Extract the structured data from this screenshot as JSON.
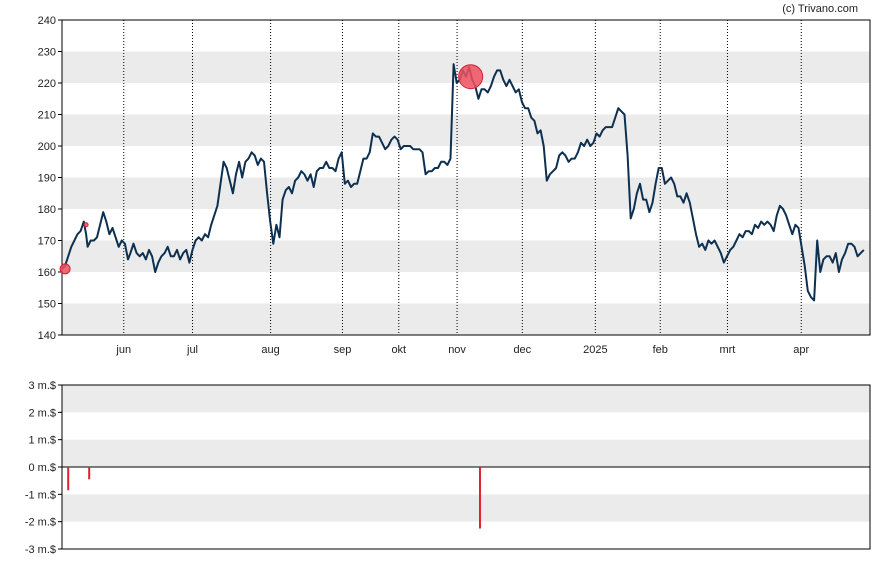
{
  "credit": "(c) Trivano.com",
  "colors": {
    "price_line": "#0d3050",
    "band": "#ebebeb",
    "marker": "#f05060",
    "marker_stroke": "#d02030",
    "volume_bar": "#e0202e",
    "grid": "#000000"
  },
  "chart_data": [
    {
      "type": "line",
      "title": "",
      "ylim": [
        140,
        240
      ],
      "y_ticks": [
        140,
        150,
        160,
        170,
        180,
        190,
        200,
        210,
        220,
        230,
        240
      ],
      "months": [
        {
          "label": "jun",
          "x": 15.9
        },
        {
          "label": "jul",
          "x": 33.6
        },
        {
          "label": "aug",
          "x": 53.7
        },
        {
          "label": "sep",
          "x": 72.2
        },
        {
          "label": "okt",
          "x": 86.7
        },
        {
          "label": "nov",
          "x": 101.7
        },
        {
          "label": "dec",
          "x": 118.5
        },
        {
          "label": "2025",
          "x": 137.3
        },
        {
          "label": "feb",
          "x": 154.0
        },
        {
          "label": "mrt",
          "x": 171.3
        },
        {
          "label": "apr",
          "x": 190.3
        }
      ],
      "x_range": [
        0,
        208
      ],
      "series": [
        {
          "points": [
            [
              0,
              161
            ],
            [
              0.8,
              162
            ],
            [
              1.6,
              165
            ],
            [
              2.4,
              168
            ],
            [
              3.2,
              170
            ],
            [
              4,
              172
            ],
            [
              4.8,
              173
            ],
            [
              5.6,
              176
            ],
            [
              6.2,
              172
            ],
            [
              6.6,
              168
            ],
            [
              7.4,
              170
            ],
            [
              8.2,
              170
            ],
            [
              9,
              171
            ],
            [
              9.8,
              175
            ],
            [
              10.6,
              179
            ],
            [
              11.4,
              176
            ],
            [
              12.2,
              172
            ],
            [
              13,
              174
            ],
            [
              13.8,
              171
            ],
            [
              14.6,
              168
            ],
            [
              15.4,
              170
            ],
            [
              16.2,
              169
            ],
            [
              17,
              164
            ],
            [
              17.6,
              166
            ],
            [
              18.4,
              169
            ],
            [
              19.2,
              166
            ],
            [
              20,
              165
            ],
            [
              20.8,
              166
            ],
            [
              21.6,
              164
            ],
            [
              22.4,
              167
            ],
            [
              23.2,
              165
            ],
            [
              24,
              160
            ],
            [
              24.8,
              163
            ],
            [
              25.6,
              165
            ],
            [
              26.4,
              166
            ],
            [
              27.2,
              168
            ],
            [
              28,
              165
            ],
            [
              28.8,
              165
            ],
            [
              29.6,
              167
            ],
            [
              30.4,
              164
            ],
            [
              31.2,
              166
            ],
            [
              32,
              167
            ],
            [
              32.8,
              163
            ],
            [
              33.6,
              167
            ],
            [
              34.4,
              170
            ],
            [
              35.2,
              171
            ],
            [
              36,
              170
            ],
            [
              36.8,
              172
            ],
            [
              37.6,
              171
            ],
            [
              38.4,
              175
            ],
            [
              39.2,
              178
            ],
            [
              40,
              181
            ],
            [
              40.8,
              188
            ],
            [
              41.6,
              195
            ],
            [
              42.4,
              193
            ],
            [
              43.2,
              189
            ],
            [
              44,
              185
            ],
            [
              44.8,
              191
            ],
            [
              45.6,
              195
            ],
            [
              46.4,
              190
            ],
            [
              47.2,
              195
            ],
            [
              48,
              196
            ],
            [
              48.8,
              198
            ],
            [
              49.6,
              197
            ],
            [
              50.4,
              194
            ],
            [
              51.2,
              196
            ],
            [
              52,
              195
            ],
            [
              52.8,
              185
            ],
            [
              53.6,
              176
            ],
            [
              54.4,
              169
            ],
            [
              55.2,
              175
            ],
            [
              56,
              171
            ],
            [
              56.8,
              183
            ],
            [
              57.6,
              186
            ],
            [
              58.4,
              187
            ],
            [
              59.2,
              185
            ],
            [
              60,
              189
            ],
            [
              60.8,
              190
            ],
            [
              61.6,
              192
            ],
            [
              62.4,
              191
            ],
            [
              63.2,
              189
            ],
            [
              64,
              191
            ],
            [
              64.8,
              187
            ],
            [
              65.6,
              192
            ],
            [
              66.4,
              193
            ],
            [
              67.2,
              193
            ],
            [
              68,
              195
            ],
            [
              68.8,
              193
            ],
            [
              69.6,
              193
            ],
            [
              70.4,
              192
            ],
            [
              71.2,
              196
            ],
            [
              72,
              198
            ],
            [
              72.8,
              188
            ],
            [
              73.6,
              189
            ],
            [
              74.4,
              187
            ],
            [
              75.2,
              188
            ],
            [
              76,
              188
            ],
            [
              76.8,
              192
            ],
            [
              77.6,
              196
            ],
            [
              78.4,
              196
            ],
            [
              79.2,
              198
            ],
            [
              80,
              204
            ],
            [
              80.8,
              203
            ],
            [
              81.6,
              203
            ],
            [
              82.4,
              201
            ],
            [
              83.2,
              199
            ],
            [
              84,
              200
            ],
            [
              84.8,
              202
            ],
            [
              85.6,
              203
            ],
            [
              86.4,
              202
            ],
            [
              87.2,
              199
            ],
            [
              88,
              200
            ],
            [
              88.8,
              200
            ],
            [
              89.6,
              200
            ],
            [
              90.4,
              199
            ],
            [
              91.2,
              199
            ],
            [
              92,
              199
            ],
            [
              92.8,
              198
            ],
            [
              93.6,
              191
            ],
            [
              94.4,
              192
            ],
            [
              95.2,
              192
            ],
            [
              96,
              193
            ],
            [
              96.8,
              193
            ],
            [
              97.6,
              195
            ],
            [
              98.4,
              195
            ],
            [
              99.2,
              194
            ],
            [
              100,
              196
            ],
            [
              100.8,
              226
            ],
            [
              101.6,
              220
            ],
            [
              102.4,
              221
            ],
            [
              103.2,
              224
            ],
            [
              104,
              222
            ],
            [
              104.8,
              225
            ],
            [
              105.6,
              221
            ],
            [
              106.4,
              219
            ],
            [
              107.2,
              215
            ],
            [
              108,
              218
            ],
            [
              108.8,
              218
            ],
            [
              109.6,
              217
            ],
            [
              110.4,
              219
            ],
            [
              111.2,
              222
            ],
            [
              112,
              224
            ],
            [
              112.8,
              224
            ],
            [
              113.6,
              221
            ],
            [
              114.4,
              219
            ],
            [
              115.2,
              221
            ],
            [
              116,
              219
            ],
            [
              116.8,
              217
            ],
            [
              117.6,
              218
            ],
            [
              118.4,
              214
            ],
            [
              119.2,
              212
            ],
            [
              120,
              212
            ],
            [
              120.8,
              209
            ],
            [
              121.6,
              208
            ],
            [
              122.4,
              204
            ],
            [
              123.2,
              205
            ],
            [
              124,
              200
            ],
            [
              124.8,
              189
            ],
            [
              125.6,
              191
            ],
            [
              126.4,
              192
            ],
            [
              127.2,
              193
            ],
            [
              128,
              197
            ],
            [
              128.8,
              198
            ],
            [
              129.6,
              197
            ],
            [
              130.4,
              195
            ],
            [
              131.2,
              196
            ],
            [
              132,
              196
            ],
            [
              132.8,
              198
            ],
            [
              133.6,
              201
            ],
            [
              134.4,
              200
            ],
            [
              135.2,
              202
            ],
            [
              136,
              200
            ],
            [
              136.8,
              201
            ],
            [
              137.6,
              204
            ],
            [
              138.4,
              203
            ],
            [
              139.2,
              205
            ],
            [
              140,
              206
            ],
            [
              140.8,
              206
            ],
            [
              141.6,
              206
            ],
            [
              142.4,
              209
            ],
            [
              143.2,
              212
            ],
            [
              144,
              211
            ],
            [
              144.8,
              210
            ],
            [
              145.6,
              197
            ],
            [
              146.4,
              177
            ],
            [
              147.2,
              180
            ],
            [
              148,
              185
            ],
            [
              148.8,
              188
            ],
            [
              149.6,
              183
            ],
            [
              150.4,
              183
            ],
            [
              151.2,
              179
            ],
            [
              152,
              182
            ],
            [
              152.8,
              188
            ],
            [
              153.6,
              193
            ],
            [
              154.4,
              193
            ],
            [
              155.2,
              188
            ],
            [
              156,
              189
            ],
            [
              156.8,
              190
            ],
            [
              157.6,
              188
            ],
            [
              158.4,
              184
            ],
            [
              159.2,
              184
            ],
            [
              160,
              182
            ],
            [
              160.8,
              185
            ],
            [
              161.6,
              182
            ],
            [
              162.4,
              177
            ],
            [
              163.2,
              172
            ],
            [
              164,
              168
            ],
            [
              164.8,
              169
            ],
            [
              165.6,
              167
            ],
            [
              166.4,
              170
            ],
            [
              167.2,
              169
            ],
            [
              168,
              170
            ],
            [
              168.8,
              168
            ],
            [
              169.6,
              166
            ],
            [
              170.4,
              163
            ],
            [
              171.2,
              165
            ],
            [
              172,
              167
            ],
            [
              172.8,
              168
            ],
            [
              173.6,
              170
            ],
            [
              174.4,
              172
            ],
            [
              175.2,
              171
            ],
            [
              176,
              173
            ],
            [
              176.8,
              173
            ],
            [
              177.6,
              172
            ],
            [
              178.4,
              175
            ],
            [
              179.2,
              174
            ],
            [
              180,
              176
            ],
            [
              180.8,
              175
            ],
            [
              181.6,
              176
            ],
            [
              182.4,
              175
            ],
            [
              183.2,
              173
            ],
            [
              184,
              178
            ],
            [
              184.8,
              181
            ],
            [
              185.6,
              180
            ],
            [
              186.4,
              178
            ],
            [
              187.2,
              175
            ],
            [
              188,
              172
            ],
            [
              188.8,
              175
            ],
            [
              189.6,
              174
            ],
            [
              190.4,
              168
            ],
            [
              191.2,
              162
            ],
            [
              192,
              154
            ],
            [
              192.8,
              152
            ],
            [
              193.6,
              151
            ],
            [
              194.4,
              170
            ],
            [
              195.2,
              160
            ],
            [
              196,
              164
            ],
            [
              196.8,
              165
            ],
            [
              197.6,
              165
            ],
            [
              198.4,
              163
            ],
            [
              199.2,
              166
            ],
            [
              200,
              160
            ],
            [
              200.8,
              164
            ],
            [
              201.6,
              166
            ],
            [
              202.4,
              169
            ],
            [
              203.2,
              169
            ],
            [
              204,
              168
            ],
            [
              204.8,
              165
            ],
            [
              205.6,
              166
            ],
            [
              206.4,
              167
            ]
          ]
        }
      ],
      "markers": [
        {
          "x": 0.8,
          "y": 161,
          "size": "small"
        },
        {
          "x": 6.2,
          "y": 175,
          "size": "tiny"
        },
        {
          "x": 105.2,
          "y": 222,
          "size": "large"
        }
      ]
    },
    {
      "type": "bar",
      "title": "",
      "ylim": [
        -3,
        3
      ],
      "y_ticks": [
        -3,
        -2,
        -1,
        0,
        1,
        2,
        3
      ],
      "y_tick_labels": [
        "-3 m.$",
        "-2 m.$",
        "-1 m.$",
        "0 m.$",
        "1 m.$",
        "2 m.$",
        "3 m.$"
      ],
      "x_range": [
        0,
        208
      ],
      "bars": [
        {
          "x": 1.6,
          "value": -0.85
        },
        {
          "x": 7.0,
          "value": -0.45
        },
        {
          "x": 107.6,
          "value": -2.25
        }
      ]
    }
  ]
}
